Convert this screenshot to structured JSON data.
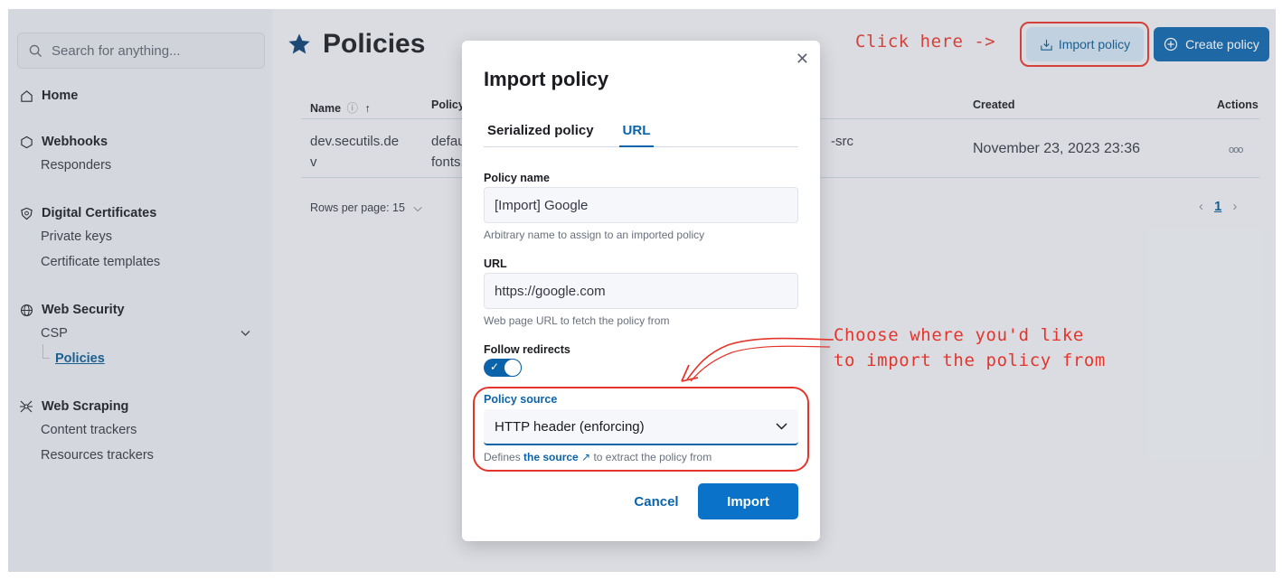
{
  "search": {
    "placeholder": "Search for anything..."
  },
  "sidebar": {
    "home": "Home",
    "webhooks": {
      "label": "Webhooks",
      "items": [
        "Responders"
      ]
    },
    "certificates": {
      "label": "Digital Certificates",
      "items": [
        "Private keys",
        "Certificate templates"
      ]
    },
    "web_security": {
      "label": "Web Security",
      "csp": "CSP",
      "policies": "Policies"
    },
    "web_scraping": {
      "label": "Web Scraping",
      "items": [
        "Content trackers",
        "Resources trackers"
      ]
    }
  },
  "header": {
    "title": "Policies",
    "import_button": "Import policy",
    "create_button": "Create policy"
  },
  "table": {
    "columns": {
      "name": "Name",
      "policy": "Policy",
      "created": "Created",
      "actions": "Actions"
    },
    "row": {
      "name_line1": "dev.secutils.de",
      "name_line2": "v",
      "policy_line1": "defau",
      "policy_line2": "fonts.",
      "policy_tail": "-src",
      "created": "November 23, 2023 23:36",
      "actions": "ooo"
    },
    "rows_per_page": "Rows per page: 15",
    "current_page": "1"
  },
  "modal": {
    "title": "Import policy",
    "tabs": [
      "Serialized policy",
      "URL"
    ],
    "active_tab": "URL",
    "policy_name": {
      "label": "Policy name",
      "value": "[Import] Google",
      "help": "Arbitrary name to assign to an imported policy"
    },
    "url": {
      "label": "URL",
      "value": "https://google.com",
      "help": "Web page URL to fetch the policy from"
    },
    "follow_redirects": {
      "label": "Follow redirects",
      "enabled": true
    },
    "policy_source": {
      "label": "Policy source",
      "selected": "HTTP header (enforcing)",
      "help_prefix": "Defines",
      "help_link": "the source",
      "help_suffix": "to extract the policy from"
    },
    "cancel_button": "Cancel",
    "import_button": "Import"
  },
  "annotations": {
    "click_here": "Click here ->",
    "choose_line1": "Choose where you'd like",
    "choose_line2": "to import the policy from"
  },
  "colors": {
    "accent": "#0b64aa",
    "annotation_red": "#e5352b"
  }
}
